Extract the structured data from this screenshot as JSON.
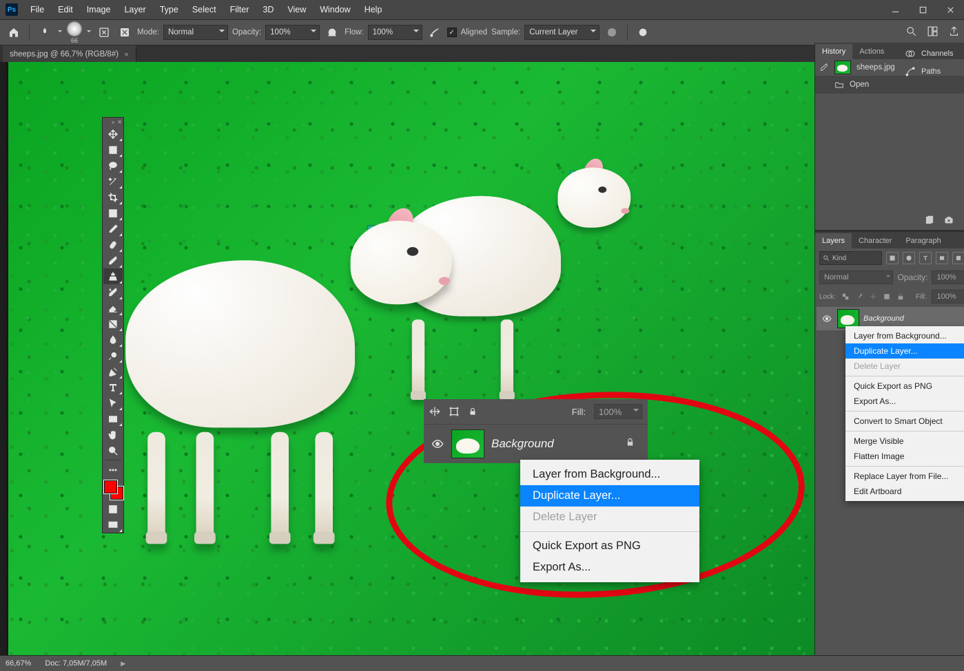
{
  "app": {
    "name": "Ps"
  },
  "menus": [
    "File",
    "Edit",
    "Image",
    "Layer",
    "Type",
    "Select",
    "Filter",
    "3D",
    "View",
    "Window",
    "Help"
  ],
  "options": {
    "brush_size": "66",
    "mode_label": "Mode:",
    "mode_value": "Normal",
    "opacity_label": "Opacity:",
    "opacity_value": "100%",
    "flow_label": "Flow:",
    "flow_value": "100%",
    "aligned_label": "Aligned",
    "sample_label": "Sample:",
    "sample_value": "Current Layer"
  },
  "doc_tab": {
    "title": "sheeps.jpg @ 66,7% (RGB/8#)"
  },
  "status": {
    "zoom": "66,67%",
    "doc_label": "Doc:",
    "doc_value": "7,05M/7,05M"
  },
  "history_panel": {
    "tabs": [
      "History",
      "Actions"
    ],
    "file": "sheeps.jpg",
    "step": "Open"
  },
  "layers_panel": {
    "tabs": [
      "Layers",
      "Character",
      "Paragraph"
    ],
    "kind": "Kind",
    "blend": "Normal",
    "opacity_label": "Opacity:",
    "opacity_value": "100%",
    "lock_label": "Lock:",
    "fill_label": "Fill:",
    "fill_value": "100%",
    "layer_name": "Background"
  },
  "zoom_preview": {
    "fill_label": "Fill:",
    "fill_value": "100%",
    "layer_name": "Background"
  },
  "context_menu": {
    "items": [
      {
        "label": "Layer from Background...",
        "type": "n"
      },
      {
        "label": "Duplicate Layer...",
        "type": "sel"
      },
      {
        "label": "Delete Layer",
        "type": "dis"
      },
      {
        "sep": true
      },
      {
        "label": "Quick Export as PNG",
        "type": "n"
      },
      {
        "label": "Export As...",
        "type": "n"
      }
    ]
  },
  "context_menu_small": {
    "items": [
      {
        "label": "Layer from Background...",
        "type": "n"
      },
      {
        "label": "Duplicate Layer...",
        "type": "sel"
      },
      {
        "label": "Delete Layer",
        "type": "dis"
      },
      {
        "sep": true
      },
      {
        "label": "Quick Export as PNG",
        "type": "n"
      },
      {
        "label": "Export As...",
        "type": "n"
      },
      {
        "sep": true
      },
      {
        "label": "Convert to Smart Object",
        "type": "n"
      },
      {
        "sep": true
      },
      {
        "label": "Merge Visible",
        "type": "n"
      },
      {
        "label": "Flatten Image",
        "type": "n"
      },
      {
        "sep": true
      },
      {
        "label": "Replace Layer from File...",
        "type": "n"
      },
      {
        "label": "Edit Artboard",
        "type": "n"
      }
    ]
  },
  "right_narrow": {
    "tabs": [
      "Channels",
      "Paths"
    ]
  }
}
